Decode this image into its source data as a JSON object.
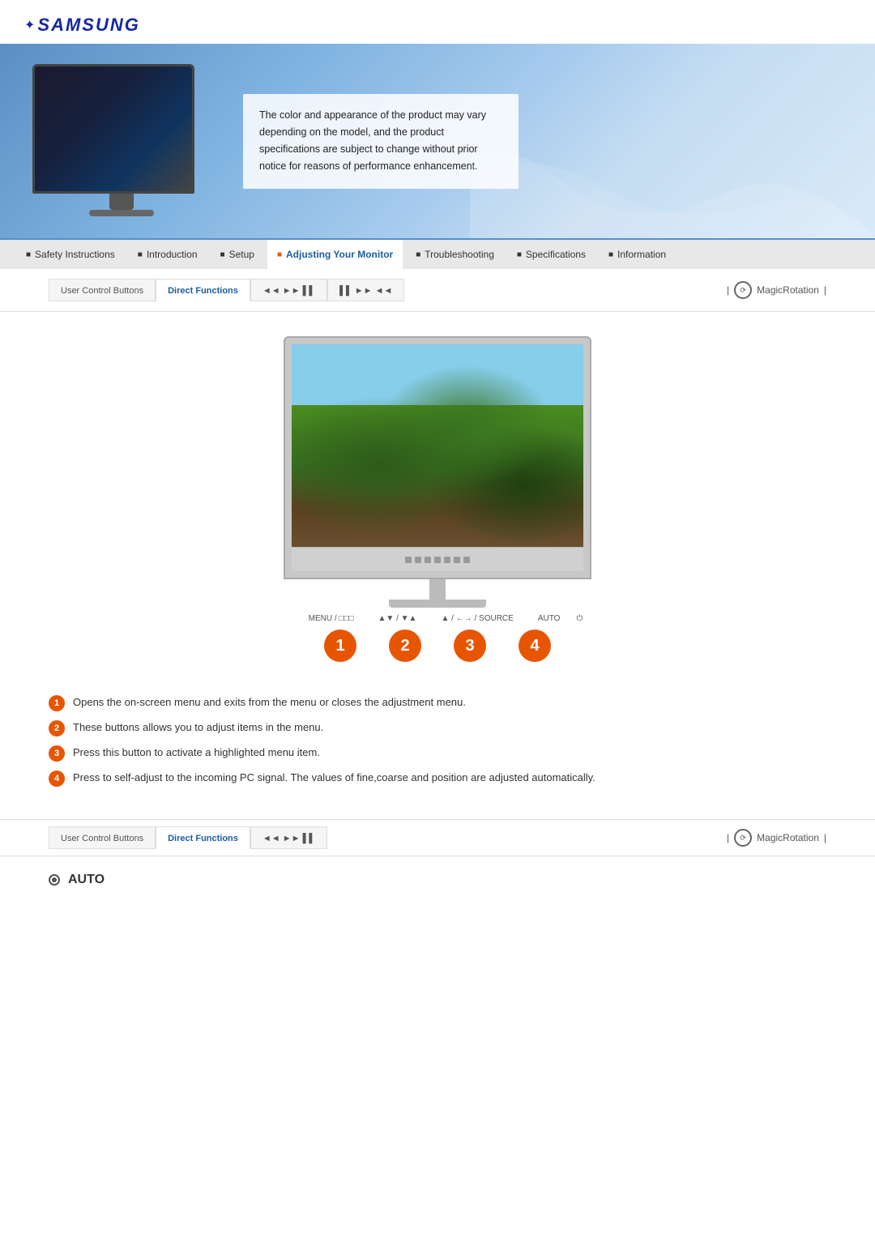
{
  "brand": {
    "name": "SAMSUNG"
  },
  "hero": {
    "description_text": "The color and appearance of the product may vary depending on the model, and the product specifications are subject to change without prior notice for reasons of performance enhancement."
  },
  "nav": {
    "items": [
      {
        "id": "safety",
        "label": "Safety Instructions",
        "active": false
      },
      {
        "id": "introduction",
        "label": "Introduction",
        "active": false
      },
      {
        "id": "setup",
        "label": "Setup",
        "active": false
      },
      {
        "id": "adjusting",
        "label": "Adjusting Your Monitor",
        "active": true
      },
      {
        "id": "troubleshooting",
        "label": "Troubleshooting",
        "active": false
      },
      {
        "id": "specifications",
        "label": "Specifications",
        "active": false
      },
      {
        "id": "information",
        "label": "Information",
        "active": false
      }
    ]
  },
  "tabs": {
    "items": [
      {
        "id": "user-control",
        "label": "User Control Buttons",
        "active": false
      },
      {
        "id": "direct-functions",
        "label": "Direct Functions",
        "active": true
      },
      {
        "id": "tab3",
        "label": "◄◄ ►► ▌▌",
        "active": false
      },
      {
        "id": "tab4",
        "label": "▌▌ ►► ◄◄",
        "active": false
      }
    ],
    "magic_rotation_label": "MagicRotation"
  },
  "monitor_diagram": {
    "menu_label": "MENU / □□□",
    "buttons_label": "▲▼ / ▼▲",
    "source_label": "▲ / ←→ / SOURCE",
    "auto_label": "AUTO",
    "power_label": "⏻"
  },
  "numbered_items": [
    {
      "num": "1",
      "desc": "Opens the on-screen menu and exits from the menu or closes the adjustment menu."
    },
    {
      "num": "2",
      "desc": "These buttons allows you to adjust items in the menu."
    },
    {
      "num": "3",
      "desc": "Press this button to activate a highlighted menu item."
    },
    {
      "num": "4",
      "desc": "Press to self-adjust to the incoming PC signal. The values of fine,coarse and position are adjusted automatically."
    }
  ],
  "bottom_tabs": {
    "items": [
      {
        "id": "user-control-b",
        "label": "User Control Buttons",
        "active": false
      },
      {
        "id": "direct-functions-b",
        "label": "Direct Functions",
        "active": true
      },
      {
        "id": "tab3b",
        "label": "◄◄ ►► ▌▌",
        "active": false
      }
    ],
    "magic_rotation_label": "MagicRotation"
  },
  "auto_section": {
    "label": "AUTO"
  }
}
